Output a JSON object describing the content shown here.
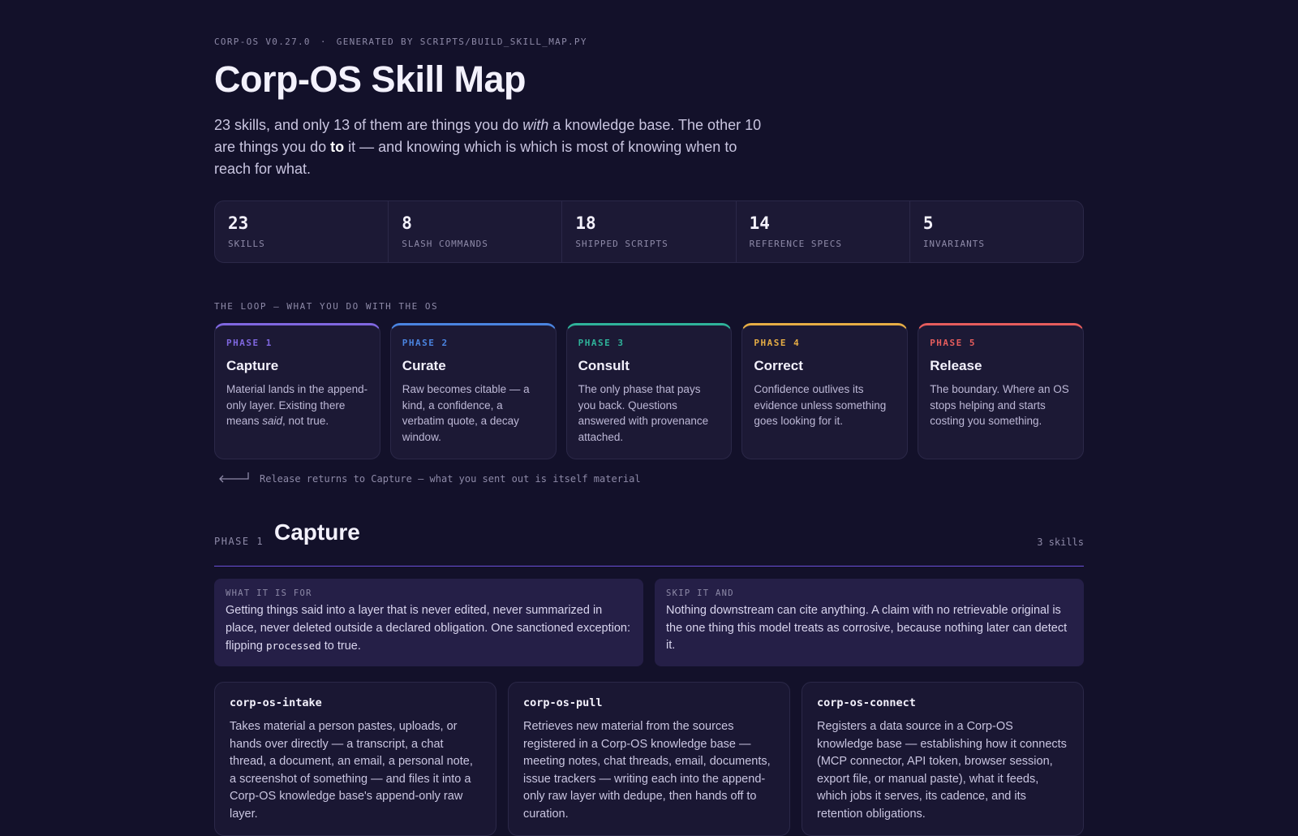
{
  "header": {
    "version": "CORP-OS V0.27.0",
    "separator": "·",
    "generated_by": "GENERATED BY SCRIPTS/BUILD_SKILL_MAP.PY",
    "title": "Corp-OS Skill Map",
    "lede_part1": "23 skills, and only 13 of them are things you do ",
    "lede_em": "with",
    "lede_part2": " a knowledge base. The other 10 are things you do ",
    "lede_strong": "to",
    "lede_part3": " it — and knowing which is which is most of knowing when to reach for what."
  },
  "stats": [
    {
      "value": "23",
      "label": "SKILLS"
    },
    {
      "value": "8",
      "label": "SLASH COMMANDS"
    },
    {
      "value": "18",
      "label": "SHIPPED SCRIPTS"
    },
    {
      "value": "14",
      "label": "REFERENCE SPECS"
    },
    {
      "value": "5",
      "label": "INVARIANTS"
    }
  ],
  "loop": {
    "section_label": "THE LOOP — WHAT YOU DO WITH THE OS",
    "phases": [
      {
        "num": "PHASE 1",
        "name": "Capture",
        "color": "#7f67e0",
        "desc_before": "Material lands in the append-only layer. Existing there means ",
        "desc_em": "said",
        "desc_after": ", not true."
      },
      {
        "num": "PHASE 2",
        "name": "Curate",
        "color": "#4a84e0",
        "desc_before": "Raw becomes citable — a kind, a confidence, a verbatim quote, a decay window.",
        "desc_em": "",
        "desc_after": ""
      },
      {
        "num": "PHASE 3",
        "name": "Consult",
        "color": "#2fb39a",
        "desc_before": "The only phase that pays you back. Questions answered with provenance attached.",
        "desc_em": "",
        "desc_after": ""
      },
      {
        "num": "PHASE 4",
        "name": "Correct",
        "color": "#e6ad45",
        "desc_before": "Confidence outlives its evidence unless something goes looking for it.",
        "desc_em": "",
        "desc_after": ""
      },
      {
        "num": "PHASE 5",
        "name": "Release",
        "color": "#e65d5d",
        "desc_before": "The boundary. Where an OS stops helping and starts costing you something.",
        "desc_em": "",
        "desc_after": ""
      }
    ],
    "return_note": "Release returns to Capture — what you sent out is itself material"
  },
  "phase_section": {
    "kicker": "PHASE 1",
    "title": "Capture",
    "count": "3 skills",
    "what_label": "WHAT IT IS FOR",
    "what_text_before": "Getting things said into a layer that is never edited, never summarized in place, never deleted outside a declared obligation. One sanctioned exception: flipping ",
    "what_code": "processed",
    "what_text_after": " to true.",
    "skip_label": "SKIP IT AND",
    "skip_text": "Nothing downstream can cite anything. A claim with no retrievable original is the one thing this model treats as corrosive, because nothing later can detect it.",
    "skills": [
      {
        "name": "corp-os-intake",
        "desc": "Takes material a person pastes, uploads, or hands over directly — a transcript, a chat thread, a document, an email, a personal note, a screenshot of something — and files it into a Corp-OS knowledge base's append-only raw layer."
      },
      {
        "name": "corp-os-pull",
        "desc": "Retrieves new material from the sources registered in a Corp-OS knowledge base — meeting notes, chat threads, email, documents, issue trackers — writing each into the append-only raw layer with dedupe, then hands off to curation."
      },
      {
        "name": "corp-os-connect",
        "desc": "Registers a data source in a Corp-OS knowledge base — establishing how it connects (MCP connector, API token, browser session, export file, or manual paste), what it feeds, which jobs it serves, its cadence, and its retention obligations."
      }
    ]
  }
}
